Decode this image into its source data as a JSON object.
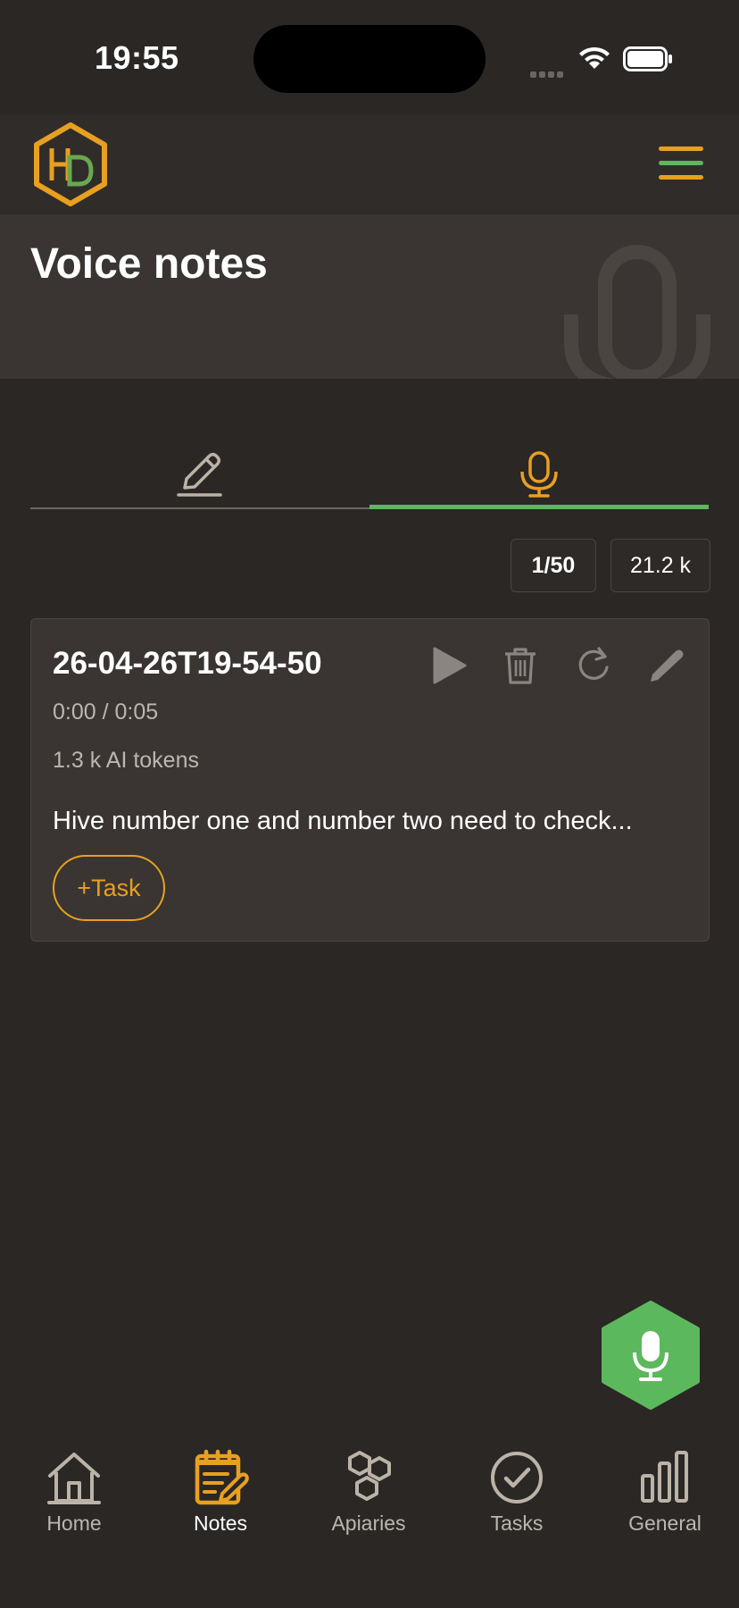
{
  "status_bar": {
    "time": "19:55"
  },
  "header": {
    "logo_icon": "hivedesk-logo",
    "menu_icon": "hamburger-menu-icon"
  },
  "page": {
    "title": "Voice notes"
  },
  "tabs": [
    {
      "icon": "pencil-icon",
      "active": false
    },
    {
      "icon": "microphone-icon",
      "active": true
    }
  ],
  "counters": {
    "notes": "1/50",
    "tokens": "21.2 k"
  },
  "notes": [
    {
      "title": "26-04-26T19-54-50",
      "duration": "0:00 / 0:05",
      "ai_tokens": "1.3 k AI tokens",
      "text": "Hive number one and number two need to check...",
      "task_button": "+Task"
    }
  ],
  "nav": {
    "items": [
      {
        "label": "Home",
        "icon": "home-icon"
      },
      {
        "label": "Notes",
        "icon": "notes-icon",
        "active": true
      },
      {
        "label": "Apiaries",
        "icon": "apiaries-icon"
      },
      {
        "label": "Tasks",
        "icon": "tasks-icon"
      },
      {
        "label": "General",
        "icon": "general-stats-icon"
      }
    ]
  },
  "colors": {
    "background": "#2a2725",
    "accent_orange": "#e8a020",
    "accent_green": "#5cb85c",
    "card": "#3a3532"
  }
}
